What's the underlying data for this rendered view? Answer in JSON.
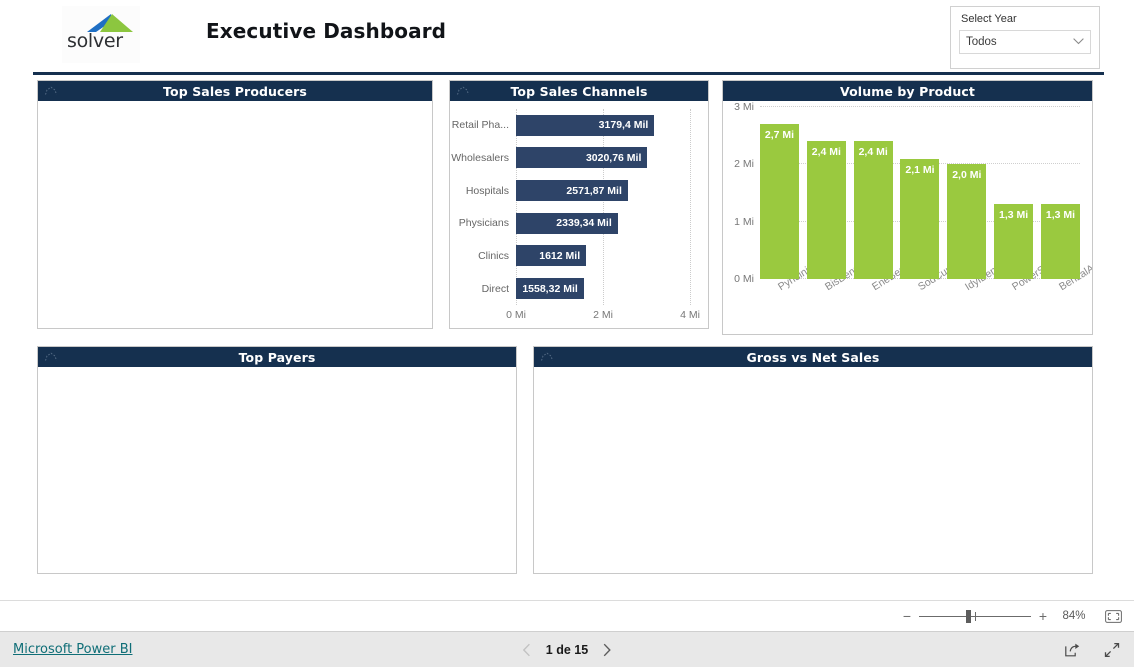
{
  "header": {
    "logo_word": "solver",
    "logo_mark": "mountain-peak-logo",
    "title": "Executive Dashboard",
    "slicer": {
      "label": "Select Year",
      "value": "Todos",
      "chevron": "chevron-down-icon"
    }
  },
  "panels": {
    "producers": {
      "title": "Top Sales Producers"
    },
    "channels": {
      "title": "Top Sales Channels"
    },
    "volume": {
      "title": "Volume by Product"
    },
    "payers": {
      "title": "Top Payers"
    },
    "grossnet": {
      "title": "Gross vs Net Sales"
    }
  },
  "chart_data": [
    {
      "id": "top_sales_channels",
      "type": "bar",
      "orientation": "horizontal",
      "title": "Top Sales Channels",
      "categories": [
        "Retail Pha...",
        "Wholesalers",
        "Hospitals",
        "Physicians",
        "Clinics",
        "Direct"
      ],
      "values": [
        3179.4,
        3020.76,
        2571.87,
        2339.34,
        1612,
        1558.32
      ],
      "value_labels": [
        "3179,4 Mil",
        "3020,76 Mil",
        "2571,87 Mil",
        "2339,34 Mil",
        "1612 Mil",
        "1558,32 Mil"
      ],
      "xlabel": "",
      "ylabel": "",
      "xlim": [
        0,
        4000
      ],
      "xticks": [
        0,
        2000,
        4000
      ],
      "xtick_labels": [
        "0 Mi",
        "2 Mi",
        "4 Mi"
      ],
      "grid": true,
      "legend": "none",
      "series_color": "#2e4468"
    },
    {
      "id": "volume_by_product",
      "type": "bar",
      "orientation": "vertical",
      "title": "Volume by Product",
      "categories": [
        "Pyridinium",
        "BisBenzene",
        "EneBenzylid",
        "SodCumene",
        "IdylBenAce",
        "PowerSulpho",
        "BenzalAce"
      ],
      "values": [
        2.7,
        2.4,
        2.4,
        2.1,
        2.0,
        1.3,
        1.3
      ],
      "value_labels": [
        "2,7 Mi",
        "2,4 Mi",
        "2,4 Mi",
        "2,1 Mi",
        "2,0 Mi",
        "1,3 Mi",
        "1,3 Mi"
      ],
      "xlabel": "",
      "ylabel": "",
      "ylim": [
        0,
        3
      ],
      "yticks": [
        0,
        1,
        2,
        3
      ],
      "ytick_labels": [
        "0 Mi",
        "1 Mi",
        "2 Mi",
        "3 Mi"
      ],
      "grid": true,
      "legend": "none",
      "series_color": "#9ac93f"
    }
  ],
  "zoombar": {
    "minus": "−",
    "plus": "+",
    "percent": "84%",
    "fit_icon": "fit-to-page-icon"
  },
  "footer": {
    "brand": "Microsoft Power BI",
    "prev_icon": "chevron-left-icon",
    "page_text": "1 de 15",
    "next_icon": "chevron-right-icon",
    "share_icon": "share-icon",
    "fullscreen_icon": "fullscreen-icon"
  },
  "colors": {
    "navy": "#15304f",
    "bar_blue": "#2e4468",
    "bar_green": "#9ac93f",
    "link_teal": "#0f6e77",
    "logo_blue": "#1f6fc4",
    "logo_green": "#8cc63f"
  }
}
